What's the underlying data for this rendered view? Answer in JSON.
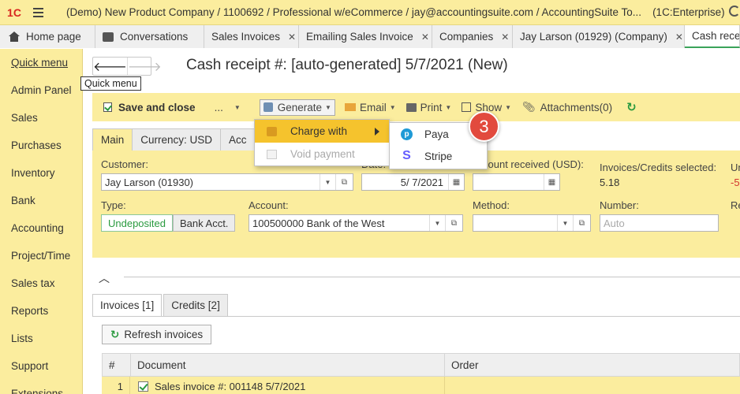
{
  "app": {
    "logo_text": "1С",
    "title": "(Demo) New Product Company / 1100692 / Professional w/eCommerce / jay@accountingsuite.com / AccountingSuite To...",
    "platform": "(1C:Enterprise)"
  },
  "tabs": [
    {
      "label": "Home page"
    },
    {
      "label": "Conversations"
    },
    {
      "label": "Sales Invoices"
    },
    {
      "label": "Emailing Sales Invoice"
    },
    {
      "label": "Companies"
    },
    {
      "label": "Jay Larson (01929) (Company)"
    },
    {
      "label": "Cash rece"
    }
  ],
  "sidebar": {
    "items": [
      {
        "label": "Quick menu"
      },
      {
        "label": "Admin Panel"
      },
      {
        "label": "Sales"
      },
      {
        "label": "Purchases"
      },
      {
        "label": "Inventory"
      },
      {
        "label": "Bank"
      },
      {
        "label": "Accounting"
      },
      {
        "label": "Project/Time"
      },
      {
        "label": "Sales tax"
      },
      {
        "label": "Reports"
      },
      {
        "label": "Lists"
      },
      {
        "label": "Support"
      },
      {
        "label": "Extensions"
      }
    ]
  },
  "tooltip": "Quick menu",
  "document": {
    "title": "Cash receipt #: [auto-generated] 5/7/2021 (New)"
  },
  "toolbar": {
    "save_close": "Save and close",
    "more": "...",
    "generate": "Generate",
    "email": "Email",
    "print": "Print",
    "show": "Show",
    "attachments": "Attachments(0)"
  },
  "form_tabs": [
    {
      "label": "Main"
    },
    {
      "label": "Currency: USD"
    },
    {
      "label": "Acc"
    }
  ],
  "form": {
    "customer_label": "Customer:",
    "customer_value": "Jay Larson (01930)",
    "date_label": "Date:",
    "date_value": "5/ 7/2021",
    "amount_label": "Amount received (USD):",
    "amount_value": "",
    "invoices_label": "Invoices/Credits selected:",
    "invoices_value": "5.18",
    "un_label": "Un",
    "un_value": "-5",
    "type_label": "Type:",
    "type_undeposited": "Undeposited",
    "type_bank": "Bank Acct.",
    "account_label": "Account:",
    "account_value": "100500000 Bank of the West",
    "method_label": "Method:",
    "method_value": "",
    "number_label": "Number:",
    "number_placeholder": "Auto",
    "re_label": "Re"
  },
  "lower_tabs": [
    {
      "label": "Invoices [1]"
    },
    {
      "label": "Credits [2]"
    }
  ],
  "refresh_invoices": "Refresh invoices",
  "table": {
    "headers": [
      "#",
      "Document",
      "Order"
    ],
    "rows": [
      {
        "num": "1",
        "document": "Sales invoice #: 001148 5/7/2021",
        "order": ""
      }
    ]
  },
  "generate_menu": {
    "items": [
      {
        "label": "Charge with"
      },
      {
        "label": "Void payment"
      }
    ]
  },
  "charge_submenu": {
    "items": [
      {
        "label": "Paya"
      },
      {
        "label": "Stripe"
      }
    ]
  },
  "step_badge": "3"
}
